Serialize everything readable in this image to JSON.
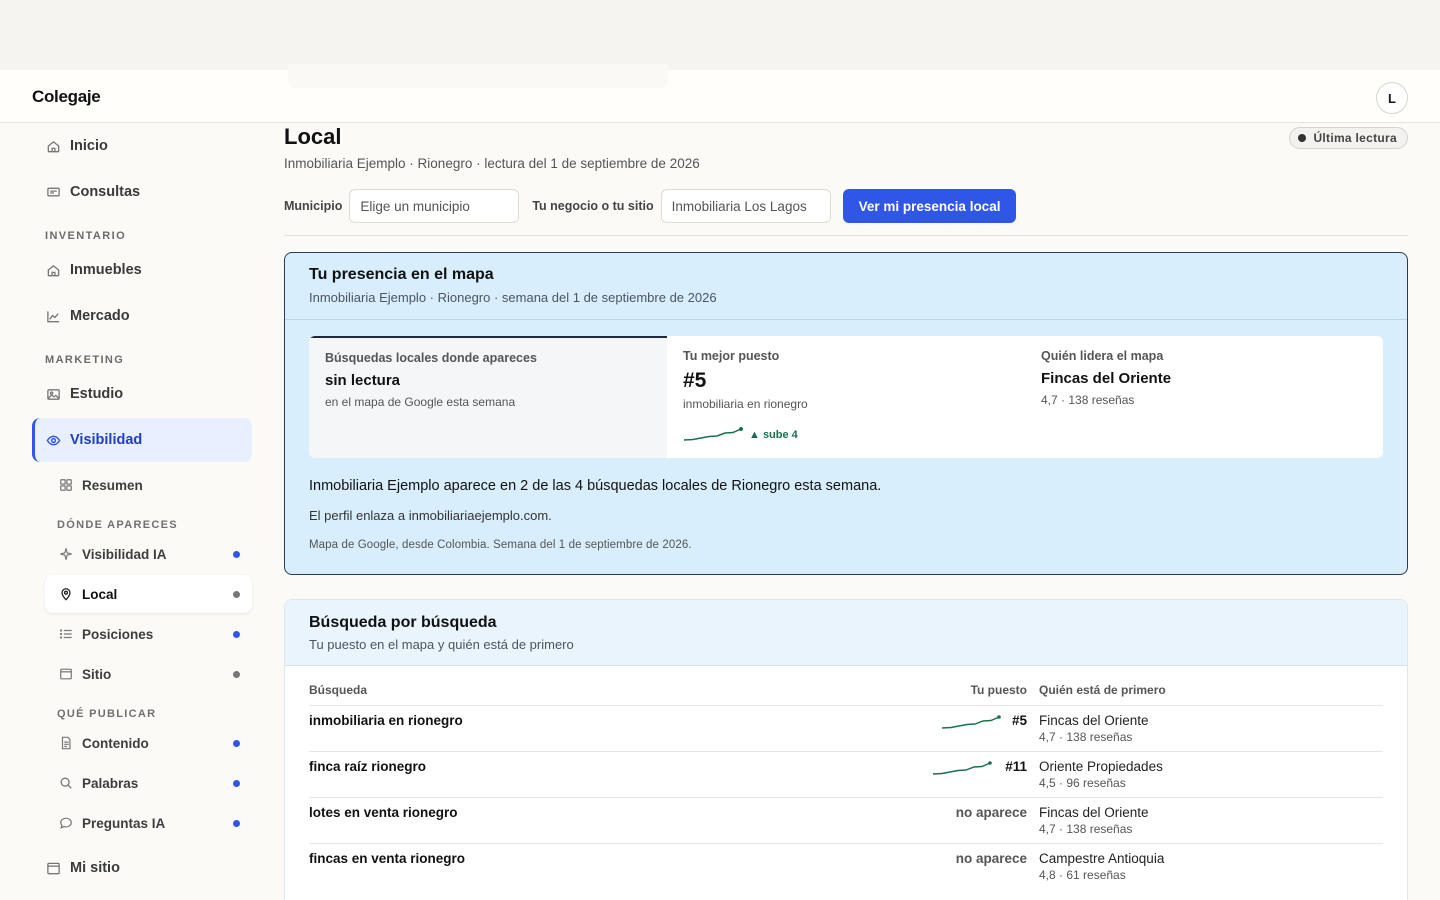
{
  "app": {
    "title": "Colegaje",
    "avatar_initial": "L"
  },
  "sidebar": {
    "top_items": [
      {
        "label": "Inicio",
        "icon": "home-icon"
      },
      {
        "label": "Consultas",
        "icon": "message-icon"
      }
    ],
    "sections": {
      "inventario": "INVENTARIO",
      "marketing": "MARKETING"
    },
    "inventario_items": [
      {
        "label": "Inmuebles",
        "icon": "home-icon"
      },
      {
        "label": "Mercado",
        "icon": "chart-icon"
      }
    ],
    "marketing_items": [
      {
        "label": "Estudio",
        "icon": "image-icon"
      },
      {
        "label": "Visibilidad",
        "icon": "eye-icon",
        "active": true
      }
    ],
    "visibilidad_sub": {
      "resumen": "Resumen",
      "donde_label": "DÓNDE APARECES",
      "que_label": "QUÉ PUBLICAR",
      "donde_items": [
        {
          "label": "Visibilidad IA",
          "icon": "sparkle-icon",
          "dot": "blue"
        },
        {
          "label": "Local",
          "icon": "map-pin-icon",
          "dot": "gray",
          "selected": true
        },
        {
          "label": "Posiciones",
          "icon": "list-icon",
          "dot": "blue"
        },
        {
          "label": "Sitio",
          "icon": "browser-icon",
          "dot": "gray"
        }
      ],
      "que_items": [
        {
          "label": "Contenido",
          "icon": "document-icon",
          "dot": "blue"
        },
        {
          "label": "Palabras",
          "icon": "search-icon",
          "dot": "blue"
        },
        {
          "label": "Preguntas IA",
          "icon": "chat-icon",
          "dot": "blue"
        }
      ]
    },
    "mi_sitio": "Mi sitio"
  },
  "page": {
    "title": "Local",
    "subtitle": "Inmobiliaria Ejemplo · Rionegro · lectura del 1 de septiembre de 2026",
    "badge": "Última lectura",
    "form": {
      "municipio_label": "Municipio",
      "municipio_placeholder": "Elige un municipio",
      "negocio_label": "Tu negocio o tu sitio",
      "negocio_value": "Inmobiliaria Los Lagos",
      "submit": "Ver mi presencia local"
    }
  },
  "map_card": {
    "title": "Tu presencia en el mapa",
    "subtitle": "Inmobiliaria Ejemplo · Rionegro · semana del 1 de septiembre de 2026",
    "stats": [
      {
        "label": "Búsquedas locales donde apareces",
        "value": "sin lectura",
        "note": "en el mapa de Google esta semana"
      },
      {
        "label": "Tu mejor puesto",
        "value": "#5",
        "note": "inmobiliaria en rionegro",
        "trend": "▲ sube 4"
      },
      {
        "label": "Quién lidera el mapa",
        "value": "Fincas del Oriente",
        "note": "4,7 · 138 reseñas"
      }
    ],
    "summary": "Inmobiliaria Ejemplo aparece en 2 de las 4 búsquedas locales de Rionegro esta semana.",
    "summary2": "El perfil enlaza a inmobiliariaejemplo.com.",
    "footnote": "Mapa de Google, desde Colombia. Semana del 1 de septiembre de 2026."
  },
  "search_card": {
    "title": "Búsqueda por búsqueda",
    "subtitle": "Tu puesto en el mapa y quién está de primero",
    "columns": {
      "query": "Búsqueda",
      "position": "Tu puesto",
      "leader": "Quién está de primero"
    },
    "rows": [
      {
        "query": "inmobiliaria en rionegro",
        "position": "#5",
        "leader": "Fincas del Oriente",
        "leader_note": "4,7 · 138 reseñas",
        "trend": true
      },
      {
        "query": "finca raíz rionegro",
        "position": "#11",
        "leader": "Oriente Propiedades",
        "leader_note": "4,5 · 96 reseñas",
        "trend": true
      },
      {
        "query": "lotes en venta rionegro",
        "position": "no aparece",
        "leader": "Fincas del Oriente",
        "leader_note": "4,7 · 138 reseñas",
        "trend": false
      },
      {
        "query": "fincas en venta rionegro",
        "position": "no aparece",
        "leader": "Campestre Antioquia",
        "leader_note": "4,8 · 61 reseñas",
        "trend": false
      }
    ]
  },
  "colors": {
    "accent": "#2f56e6",
    "map_card_bg": "#d8eefc",
    "trend_green": "#17714b"
  }
}
